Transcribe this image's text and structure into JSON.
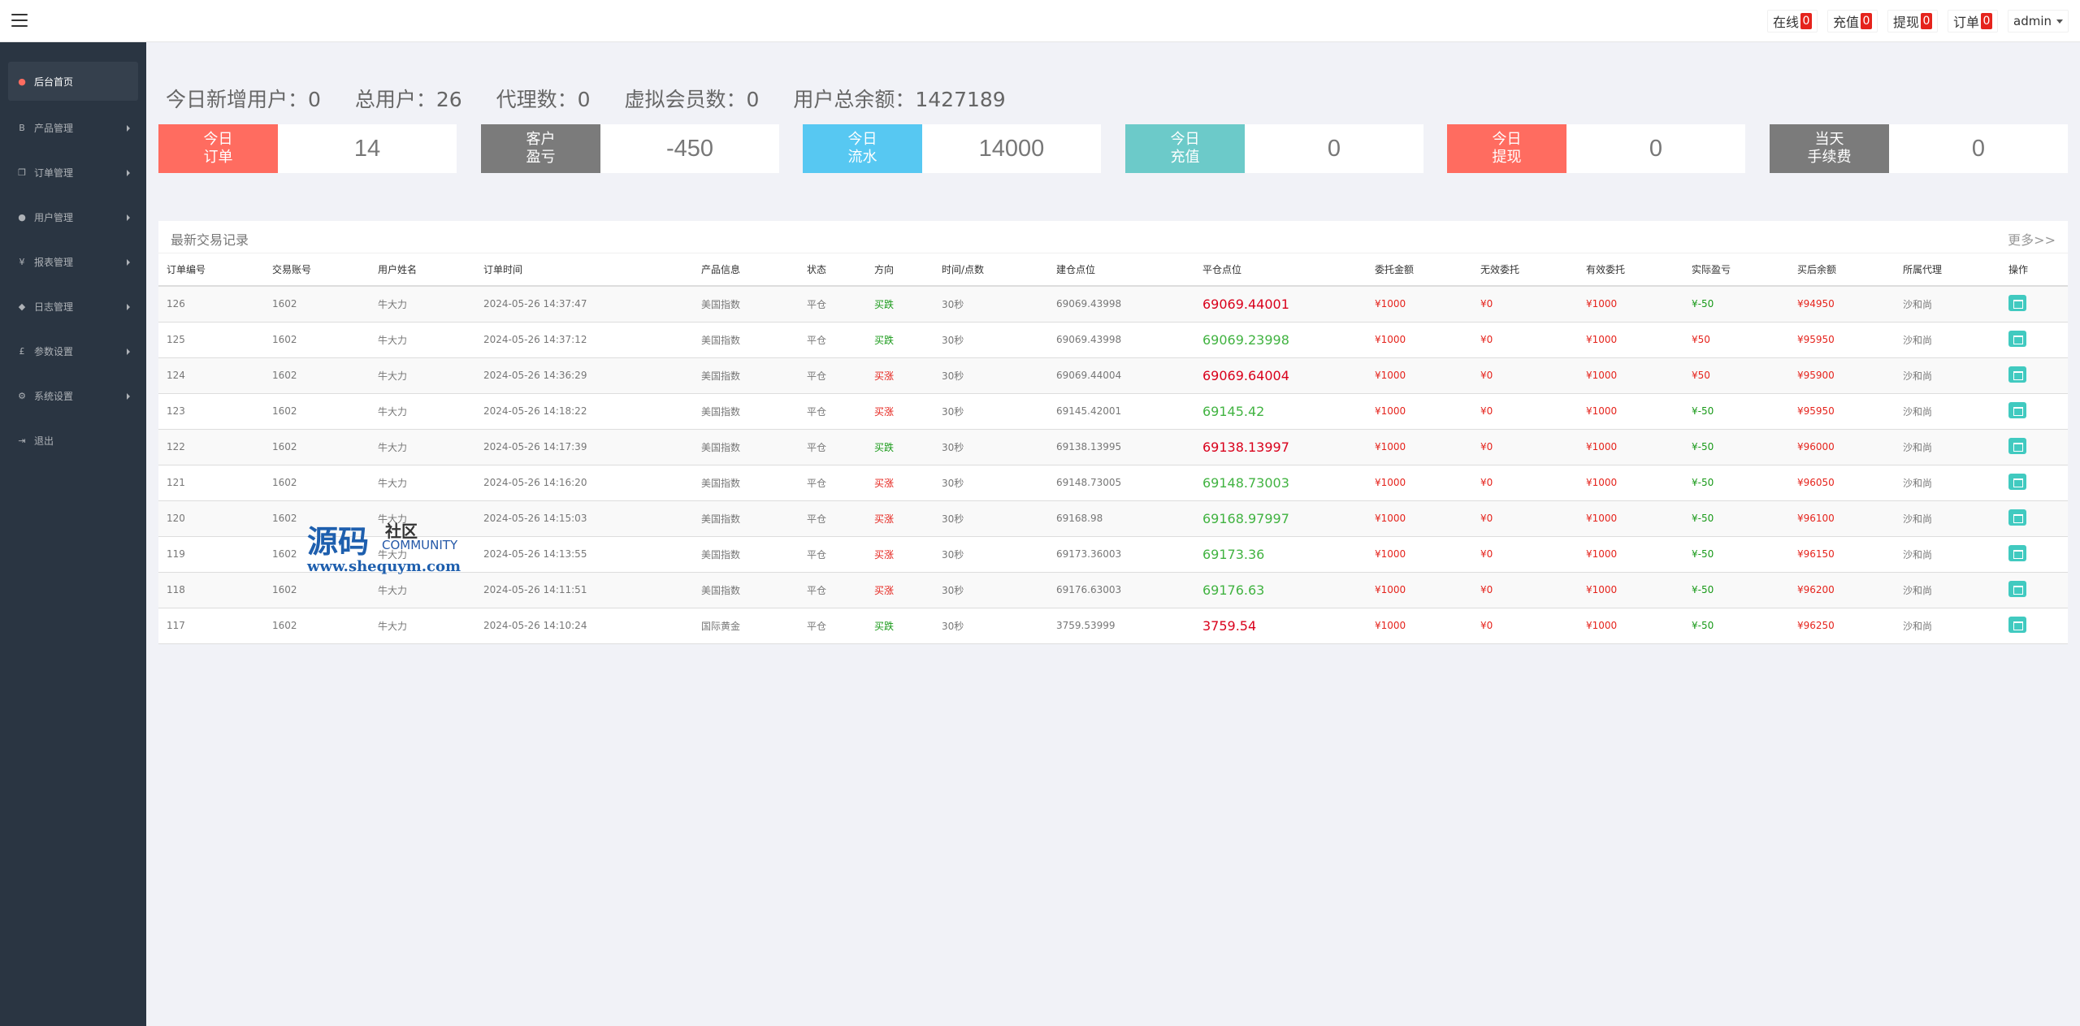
{
  "topbar": {
    "items": [
      {
        "label": "在线",
        "count": "0"
      },
      {
        "label": "充值",
        "count": "0"
      },
      {
        "label": "提现",
        "count": "0"
      },
      {
        "label": "订单",
        "count": "0"
      }
    ],
    "user": "admin"
  },
  "sidebar": {
    "items": [
      {
        "label": "后台首页",
        "icon": "dashboard-icon"
      },
      {
        "label": "产品管理",
        "icon": "bitcoin-icon"
      },
      {
        "label": "订单管理",
        "icon": "copy-icon"
      },
      {
        "label": "用户管理",
        "icon": "user-icon"
      },
      {
        "label": "报表管理",
        "icon": "yen-icon"
      },
      {
        "label": "日志管理",
        "icon": "tags-icon"
      },
      {
        "label": "参数设置",
        "icon": "pound-icon"
      },
      {
        "label": "系统设置",
        "icon": "cogs-icon"
      },
      {
        "label": "退出",
        "icon": "logout-icon"
      }
    ]
  },
  "stats": {
    "new_users": "今日新增用户：0",
    "total_users": "总用户：26",
    "agents": "代理数：0",
    "virtual_members": "虚拟会员数：0",
    "total_balance": "用户总余额：1427189"
  },
  "cards": [
    {
      "line1": "今日",
      "line2": "订单",
      "value": "14",
      "color": "#ff6c60"
    },
    {
      "line1": "客户",
      "line2": "盈亏",
      "value": "-450",
      "color": "#7b7b7b"
    },
    {
      "line1": "今日",
      "line2": "流水",
      "value": "14000",
      "color": "#57c8f2"
    },
    {
      "line1": "今日",
      "line2": "充值",
      "value": "0",
      "color": "#6ccac9"
    },
    {
      "line1": "今日",
      "line2": "提现",
      "value": "0",
      "color": "#ff6c60"
    },
    {
      "line1": "当天",
      "line2": "手续费",
      "value": "0",
      "color": "#7b7b7b"
    }
  ],
  "table": {
    "title": "最新交易记录",
    "more": "更多>>",
    "headers": [
      "订单编号",
      "交易账号",
      "用户姓名",
      "订单时间",
      "产品信息",
      "状态",
      "方向",
      "时间/点数",
      "建仓点位",
      "平仓点位",
      "委托金额",
      "无效委托",
      "有效委托",
      "实际盈亏",
      "买后余额",
      "所属代理",
      "操作"
    ],
    "rows": [
      [
        "126",
        "1602",
        "牛大力",
        "2024-05-26 14:37:47",
        "美国指数",
        "平仓",
        "买跌",
        "30秒",
        "69069.43998",
        "69069.44001",
        "¥1000",
        "¥0",
        "¥1000",
        "¥-50",
        "¥94950",
        "沙和尚"
      ],
      [
        "125",
        "1602",
        "牛大力",
        "2024-05-26 14:37:12",
        "美国指数",
        "平仓",
        "买跌",
        "30秒",
        "69069.43998",
        "69069.23998",
        "¥1000",
        "¥0",
        "¥1000",
        "¥50",
        "¥95950",
        "沙和尚"
      ],
      [
        "124",
        "1602",
        "牛大力",
        "2024-05-26 14:36:29",
        "美国指数",
        "平仓",
        "买涨",
        "30秒",
        "69069.44004",
        "69069.64004",
        "¥1000",
        "¥0",
        "¥1000",
        "¥50",
        "¥95900",
        "沙和尚"
      ],
      [
        "123",
        "1602",
        "牛大力",
        "2024-05-26 14:18:22",
        "美国指数",
        "平仓",
        "买涨",
        "30秒",
        "69145.42001",
        "69145.42",
        "¥1000",
        "¥0",
        "¥1000",
        "¥-50",
        "¥95950",
        "沙和尚"
      ],
      [
        "122",
        "1602",
        "牛大力",
        "2024-05-26 14:17:39",
        "美国指数",
        "平仓",
        "买跌",
        "30秒",
        "69138.13995",
        "69138.13997",
        "¥1000",
        "¥0",
        "¥1000",
        "¥-50",
        "¥96000",
        "沙和尚"
      ],
      [
        "121",
        "1602",
        "牛大力",
        "2024-05-26 14:16:20",
        "美国指数",
        "平仓",
        "买涨",
        "30秒",
        "69148.73005",
        "69148.73003",
        "¥1000",
        "¥0",
        "¥1000",
        "¥-50",
        "¥96050",
        "沙和尚"
      ],
      [
        "120",
        "1602",
        "牛大力",
        "2024-05-26 14:15:03",
        "美国指数",
        "平仓",
        "买涨",
        "30秒",
        "69168.98",
        "69168.97997",
        "¥1000",
        "¥0",
        "¥1000",
        "¥-50",
        "¥96100",
        "沙和尚"
      ],
      [
        "119",
        "1602",
        "牛大力",
        "2024-05-26 14:13:55",
        "美国指数",
        "平仓",
        "买涨",
        "30秒",
        "69173.36003",
        "69173.36",
        "¥1000",
        "¥0",
        "¥1000",
        "¥-50",
        "¥96150",
        "沙和尚"
      ],
      [
        "118",
        "1602",
        "牛大力",
        "2024-05-26 14:11:51",
        "美国指数",
        "平仓",
        "买涨",
        "30秒",
        "69176.63003",
        "69176.63",
        "¥1000",
        "¥0",
        "¥1000",
        "¥-50",
        "¥96200",
        "沙和尚"
      ],
      [
        "117",
        "1602",
        "牛大力",
        "2024-05-26 14:10:24",
        "国际黄金",
        "平仓",
        "买跌",
        "30秒",
        "3759.53999",
        "3759.54",
        "¥1000",
        "¥0",
        "¥1000",
        "¥-50",
        "¥96250",
        "沙和尚"
      ]
    ],
    "close_colors": [
      "red",
      "green",
      "red",
      "green",
      "red",
      "green",
      "green",
      "green",
      "green",
      "red"
    ],
    "pnl_colors": [
      "green",
      "red",
      "red",
      "green",
      "green",
      "green",
      "green",
      "green",
      "green",
      "green"
    ]
  },
  "watermark": {
    "big": "源码",
    "small1": "社区",
    "small2": "COMMUNITY",
    "url": "www.shequym.com"
  }
}
